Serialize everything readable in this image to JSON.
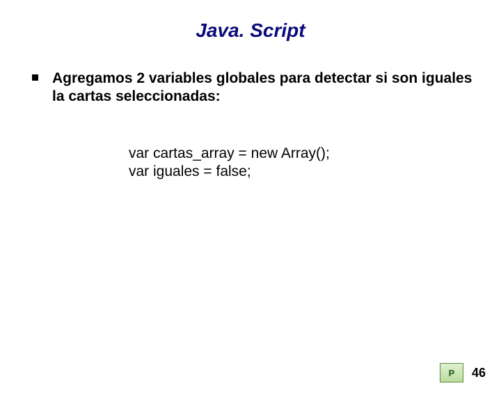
{
  "title": "Java. Script",
  "bullet": {
    "text": "Agregamos 2 variables globales para detectar si son iguales la cartas seleccionadas:"
  },
  "code": {
    "line1": "var cartas_array = new Array();",
    "line2": "var iguales = false;"
  },
  "footer": {
    "logo_text": "P",
    "page_number": "46"
  }
}
